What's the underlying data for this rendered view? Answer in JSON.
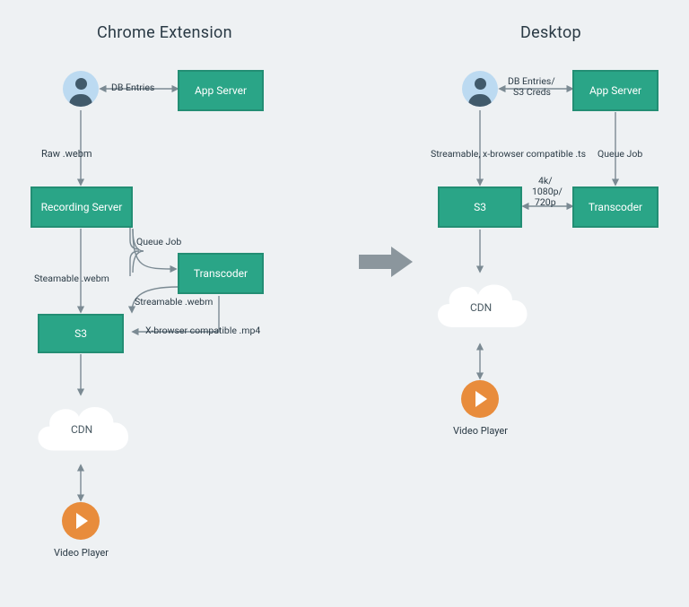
{
  "titles": {
    "left": "Chrome Extension",
    "right": "Desktop"
  },
  "nodes": {
    "appServer": "App Server",
    "recordingServer": "Recording Server",
    "transcoder": "Transcoder",
    "s3": "S3",
    "cdn": "CDN",
    "videoPlayer": "Video Player"
  },
  "edges": {
    "dbEntries": "DB Entries",
    "rawWebm": "Raw .webm",
    "queueJob": "Queue Job",
    "streamableWebm": "Steamable .webm",
    "streamableWebm2": "Streamable .webm",
    "xBrowserMp4": "X-browser compatible .mp4",
    "dbEntriesS3Creds1": "DB Entries/",
    "dbEntriesS3Creds2": "S3 Creds",
    "streamableTs": "Streamable, x-browser compatible .ts",
    "resolutions1": "4k/",
    "resolutions2": "1080p/",
    "resolutions3": "720p"
  }
}
